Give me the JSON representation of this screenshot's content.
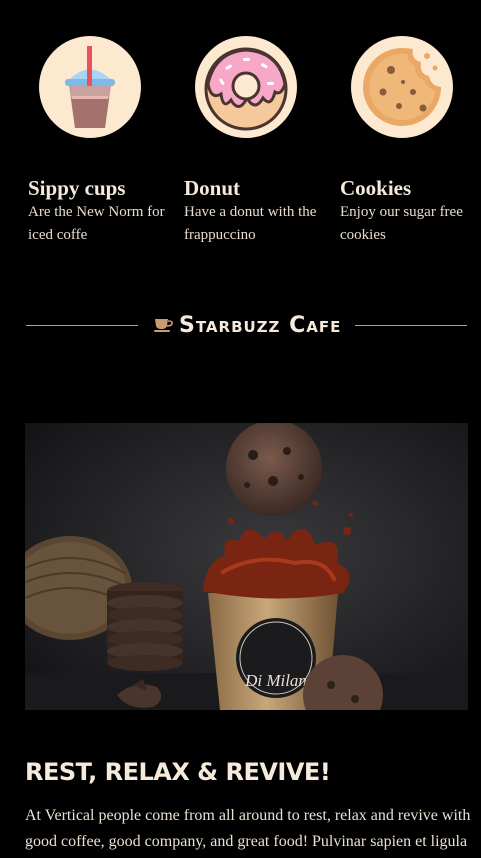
{
  "features": [
    {
      "icon": "sippy-cup-icon",
      "title": "Sippy cups",
      "description": "Are the New Norm for iced coffe"
    },
    {
      "icon": "donut-icon",
      "title": "Donut",
      "description": "Have a donut with the frappuccino"
    },
    {
      "icon": "cookie-icon",
      "title": "Cookies",
      "description": "Enjoy our sugar free cookies"
    }
  ],
  "divider": {
    "icon": "coffee-cup-icon",
    "brand": "Starbuzz Cafe"
  },
  "hero": {
    "image": "cookie-coffee-splash-photo",
    "cup_text": "Di Milan"
  },
  "about": {
    "headline": "REST, RELAX & REVIVE!",
    "body": "At Vertical people come from all around to rest, relax and revive with good coffee, good company, and great food! Pulvinar sapien et ligula"
  },
  "colors": {
    "background": "#000000",
    "circle": "#fde8d0",
    "accent_line": "#c79b73",
    "text": "#f6eadc"
  }
}
